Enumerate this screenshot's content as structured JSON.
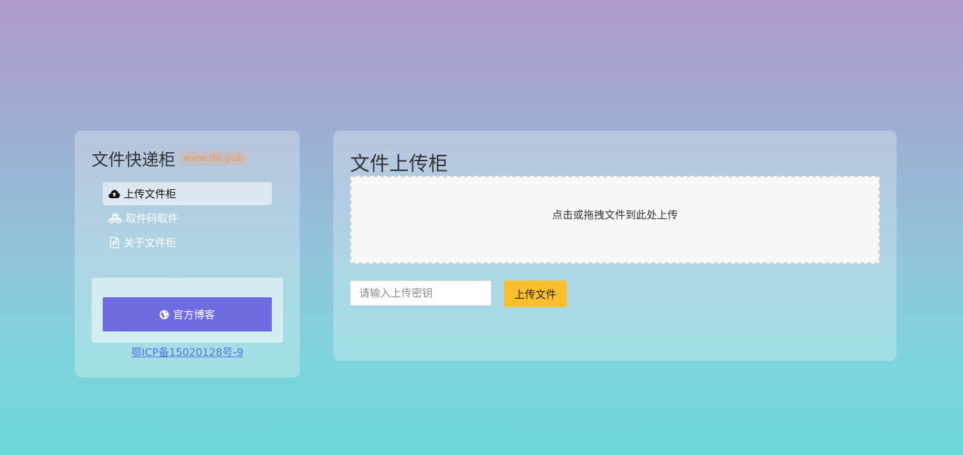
{
  "sidebar": {
    "brand_title": "文件快递柜",
    "brand_badge": "www.fbl.pub",
    "nav": [
      {
        "label": "上传文件柜",
        "icon": "cloud-upload-icon",
        "active": true
      },
      {
        "label": "取件码取件",
        "icon": "cubes-icon",
        "active": false
      },
      {
        "label": "关于文件柜",
        "icon": "file-icon",
        "active": false
      }
    ],
    "blog_button_label": "官方博客",
    "blog_button_icon": "globe-icon",
    "icp_text": "鄂ICP备15020128号-9"
  },
  "main": {
    "title": "文件上传柜",
    "dropzone_text": "点击或拖拽文件到此处上传",
    "key_input": {
      "value": "",
      "placeholder": "请输入上传密钥"
    },
    "upload_button_label": "上传文件"
  },
  "colors": {
    "accent_purple": "#6f6be0",
    "accent_yellow": "#fbbf2e",
    "link_blue": "#5a6fe2",
    "badge_orange": "#ec9a66"
  }
}
